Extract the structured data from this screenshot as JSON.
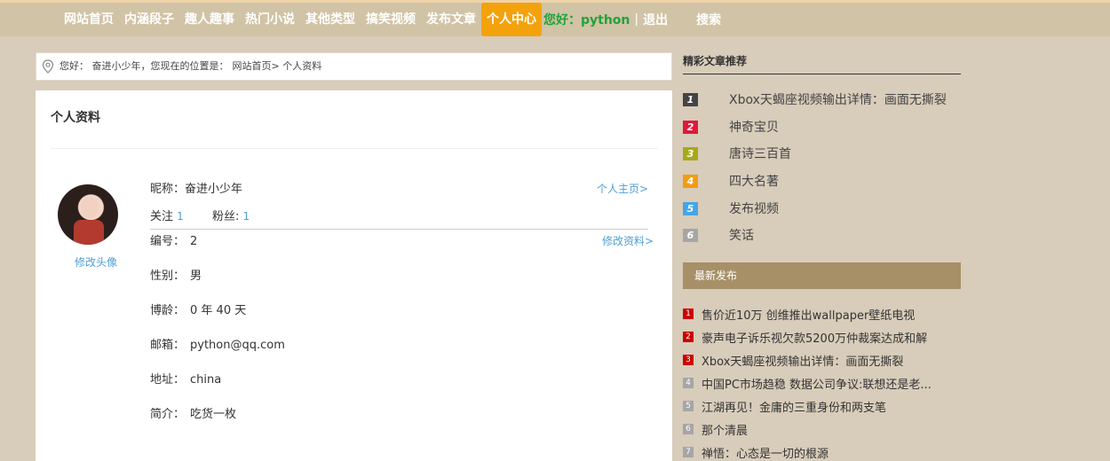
{
  "nav": {
    "items": [
      "网站首页",
      "内涵段子",
      "趣人趣事",
      "热门小说",
      "其他类型",
      "搞笑视频",
      "发布文章",
      "个人中心"
    ],
    "greeting": "您好：python",
    "separator": "|",
    "logout": "退出",
    "search": "搜索"
  },
  "breadcrumb": {
    "text1": "您好： 奋进小少年，您现在的位置是：",
    "home": "网站首页>",
    "current": "个人资料"
  },
  "profile": {
    "title": "个人资料",
    "change_avatar": "修改头像",
    "nickname_label": "昵称：",
    "nickname": "奋进小少年",
    "homepage_link": "个人主页>",
    "follow_label": "关注",
    "follow_count": "1",
    "fans_label": "粉丝:",
    "fans_count": "1",
    "edit_link": "修改资料>",
    "fields": [
      {
        "label": "编号：",
        "value": "2"
      },
      {
        "label": "性别：",
        "value": "男"
      },
      {
        "label": "博龄：",
        "value": "0 年 40 天"
      },
      {
        "label": "邮箱：",
        "value": "python@qq.com"
      },
      {
        "label": "地址：",
        "value": "china"
      },
      {
        "label": "简介：",
        "value": "吃货一枚"
      }
    ]
  },
  "recommend": {
    "title": "精彩文章推荐",
    "items": [
      {
        "rank": "1",
        "color": "#444444",
        "text": "Xbox天蝎座视频输出详情：画面无撕裂"
      },
      {
        "rank": "2",
        "color": "#e0183c",
        "text": "神奇宝贝"
      },
      {
        "rank": "3",
        "color": "#a8a81a",
        "text": "唐诗三百首"
      },
      {
        "rank": "4",
        "color": "#f39c12",
        "text": "四大名著"
      },
      {
        "rank": "5",
        "color": "#45a5e6",
        "text": "发布视频"
      },
      {
        "rank": "6",
        "color": "#a6a6a6",
        "text": "笑话"
      }
    ]
  },
  "latest": {
    "title": "最新发布",
    "items": [
      {
        "rank": "1",
        "color": "#cc0000",
        "text": "售价近10万 创维推出wallpaper壁纸电视"
      },
      {
        "rank": "2",
        "color": "#cc0000",
        "text": "豪声电子诉乐视欠款5200万仲裁案达成和解"
      },
      {
        "rank": "3",
        "color": "#cc0000",
        "text": "Xbox天蝎座视频输出详情：画面无撕裂"
      },
      {
        "rank": "4",
        "color": "#a6a6a6",
        "text": "中国PC市场趋稳 数据公司争议:联想还是老..."
      },
      {
        "rank": "5",
        "color": "#a6a6a6",
        "text": "江湖再见！金庸的三重身份和两支笔"
      },
      {
        "rank": "6",
        "color": "#a6a6a6",
        "text": "那个清晨"
      },
      {
        "rank": "7",
        "color": "#a6a6a6",
        "text": "禅悟：心态是一切的根源"
      }
    ]
  }
}
